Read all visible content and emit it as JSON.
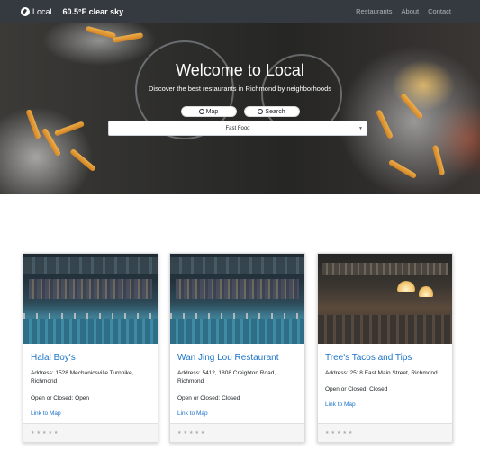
{
  "navbar": {
    "brand": "Local",
    "weather": "60.5°F  clear sky",
    "links": [
      "Restaurants",
      "About",
      "Contact"
    ]
  },
  "hero": {
    "title": "Welcome to Local",
    "subtitle": "Discover the best restaurants in Richmond by neighborhoods",
    "map_button": "Map",
    "search_button": "Search",
    "select_value": "Fast Food"
  },
  "cards": [
    {
      "title": "Halal Boy's",
      "address": "Address: 1528 Mechanicsville Turnpike, Richmond",
      "status": "Open or Closed: Open",
      "link": "Link to Map",
      "rating": "★★★★★"
    },
    {
      "title": "Wan Jing Lou Restaurant",
      "address": "Address: 5412, 1808 Creighton Road, Richmond",
      "status": "Open or Closed: Closed",
      "link": "Link to Map",
      "rating": "★★★★★"
    },
    {
      "title": "Tree's Tacos and Tips",
      "address": "Address: 2518 East Main Street, Richmond",
      "status": "Open or Closed: Closed",
      "link": "Link to Map",
      "rating": "★★★★★"
    }
  ]
}
